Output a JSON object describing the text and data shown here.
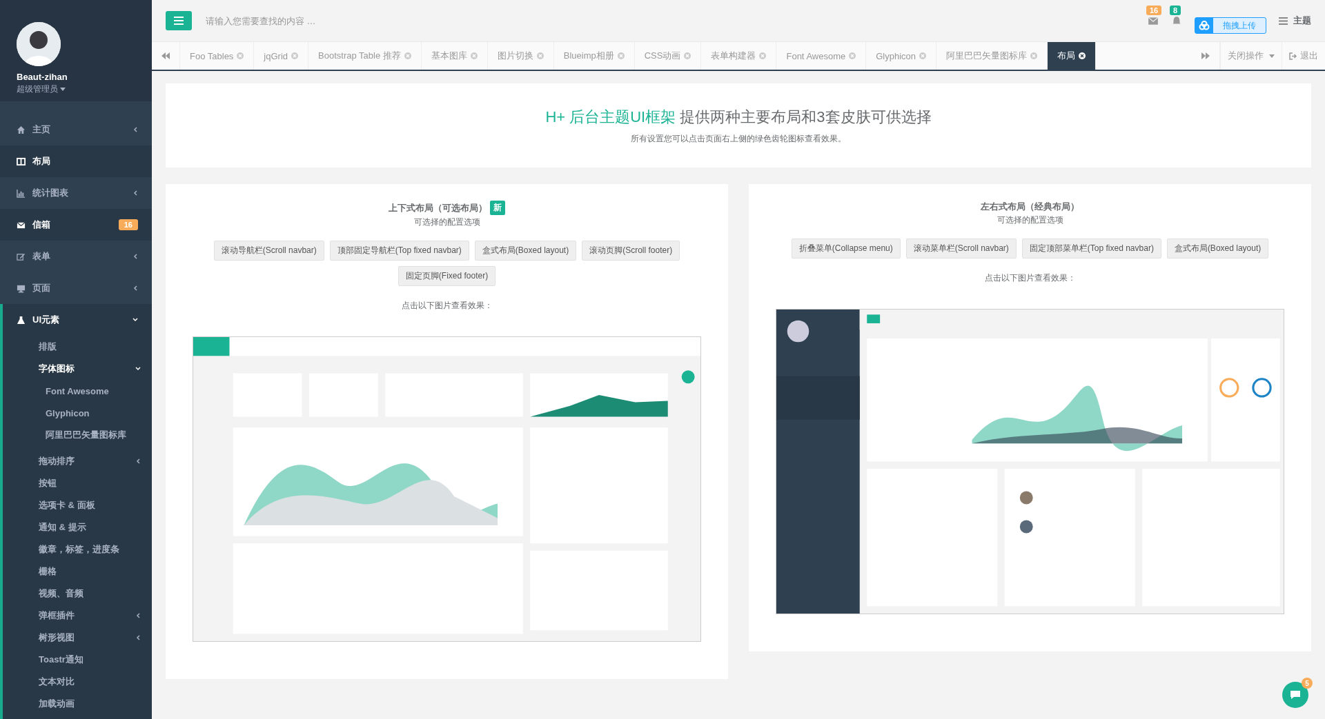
{
  "sidebar": {
    "profile": {
      "name": "Beaut-zihan",
      "role": "超级管理员"
    },
    "items": [
      {
        "label": "主页",
        "active": false,
        "expanded": false
      },
      {
        "label": "布局",
        "active": true
      },
      {
        "label": "统计图表",
        "active": false,
        "expanded": false
      },
      {
        "label": "信箱",
        "active": true,
        "badge": "16"
      },
      {
        "label": "表单",
        "active": false,
        "expanded": false
      },
      {
        "label": "页面",
        "active": false,
        "expanded": false
      },
      {
        "label": "UI元素",
        "active": true,
        "expanded": true,
        "children": [
          {
            "label": "排版"
          },
          {
            "label": "字体图标",
            "active": true,
            "expanded": true,
            "children": [
              {
                "label": "Font Awesome"
              },
              {
                "label": "Glyphicon"
              },
              {
                "label": "阿里巴巴矢量图标库"
              }
            ]
          },
          {
            "label": "拖动排序",
            "expanded": false
          },
          {
            "label": "按钮"
          },
          {
            "label": "选项卡 & 面板"
          },
          {
            "label": "通知 & 提示"
          },
          {
            "label": "徽章，标签，进度条"
          },
          {
            "label": "栅格"
          },
          {
            "label": "视频、音频"
          },
          {
            "label": "弹框插件",
            "expanded": false
          },
          {
            "label": "树形视图",
            "expanded": false
          },
          {
            "label": "Toastr通知"
          },
          {
            "label": "文本对比"
          },
          {
            "label": "加载动画"
          }
        ]
      }
    ]
  },
  "topbar": {
    "search": {
      "placeholder": "请输入您需要查找的内容 …"
    },
    "mail_badge": "16",
    "bell_badge": "8",
    "upload": "拖拽上传",
    "theme": "主题"
  },
  "tabs": [
    {
      "label": "Foo Tables",
      "selected": false
    },
    {
      "label": "jqGrid",
      "selected": false
    },
    {
      "label": "Bootstrap Table 推荐",
      "selected": false
    },
    {
      "label": "基本图库",
      "selected": false
    },
    {
      "label": "图片切换",
      "selected": false
    },
    {
      "label": "Blueimp相册",
      "selected": false
    },
    {
      "label": "CSS动画",
      "selected": false
    },
    {
      "label": "表单构建器",
      "selected": false
    },
    {
      "label": "Font Awesome",
      "selected": false
    },
    {
      "label": "Glyphicon",
      "selected": false
    },
    {
      "label": "阿里巴巴矢量图标库",
      "selected": false
    },
    {
      "label": "布局",
      "selected": true
    }
  ],
  "tab_actions": {
    "close": "关闭操作",
    "logout": "退出"
  },
  "header": {
    "title_highlight": "H+ 后台主题UI框架",
    "title_rest": "提供两种主要布局和3套皮肤可供选择",
    "subtitle": "所有设置您可以点击页面右上侧的绿色齿轮图标查看效果。"
  },
  "cards": [
    {
      "title": "上下式布局（可选布局）",
      "badge": "新",
      "subtitle": "可选择的配置选项",
      "buttons": [
        "滚动导航栏(Scroll navbar)",
        "顶部固定导航栏(Top fixed navbar)",
        "盒式布局(Boxed layout)",
        "滚动页脚(Scroll footer)",
        "固定页脚(Fixed footer)"
      ],
      "hint": "点击以下图片查看效果：",
      "preview": {
        "kind": "picture"
      }
    },
    {
      "title": "左右式布局（经典布局）",
      "subtitle": "可选择的配置选项",
      "buttons": [
        "折叠菜单(Collapse menu)",
        "滚动菜单栏(Scroll navbar)",
        "固定顶部菜单栏(Top fixed navbar)",
        "盒式布局(Boxed layout)"
      ],
      "hint": "点击以下图片查看效果：",
      "preview": {
        "kind": "picture"
      }
    }
  ],
  "chat_badge": "5"
}
